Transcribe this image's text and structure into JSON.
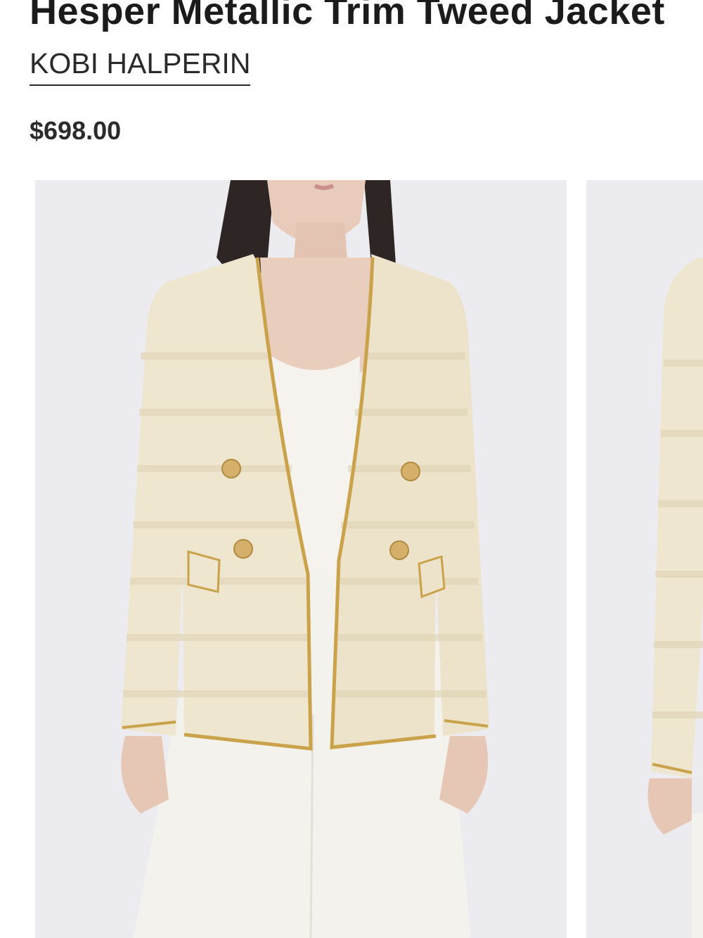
{
  "product": {
    "title": "Hesper Metallic Trim Tweed Jacket",
    "brand": "KOBI HALPERIN",
    "price": "$698.00"
  },
  "gallery": {
    "images": [
      {
        "subject": "model wearing cream tweed jacket with gold trim and gold buttons, front view"
      },
      {
        "subject": "model wearing cream tweed jacket, alternate view (partially visible)"
      }
    ]
  },
  "colors": {
    "background": "#ffffff",
    "photo_backdrop": "#ececf0",
    "jacket": "#efe6cf",
    "trim": "#c9a24a",
    "button": "#d4b06a",
    "pants": "#f4f2ec",
    "text": "#1b1b1b"
  }
}
